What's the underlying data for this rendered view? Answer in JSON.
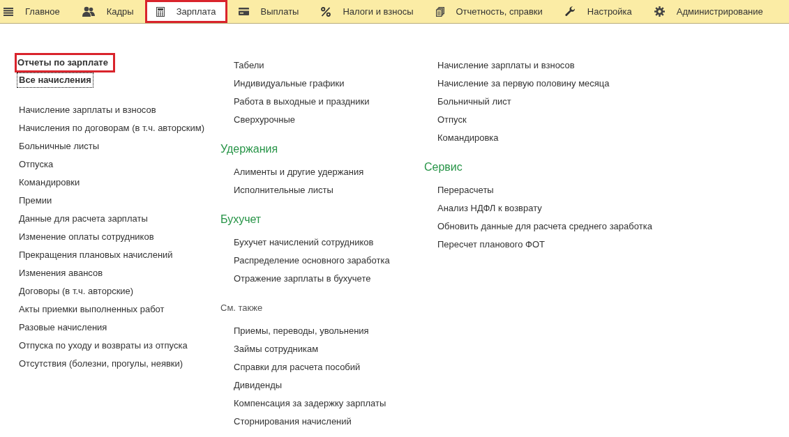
{
  "tabs": [
    {
      "label": "Главное",
      "selected": false,
      "highlighted": false
    },
    {
      "label": "Кадры",
      "selected": false,
      "highlighted": false
    },
    {
      "label": "Зарплата",
      "selected": true,
      "highlighted": true
    },
    {
      "label": "Выплаты",
      "selected": false,
      "highlighted": false
    },
    {
      "label": "Налоги и взносы",
      "selected": false,
      "highlighted": false
    },
    {
      "label": "Отчетность, справки",
      "selected": false,
      "highlighted": false
    },
    {
      "label": "Настройка",
      "selected": false,
      "highlighted": false
    },
    {
      "label": "Администрирование",
      "selected": false,
      "highlighted": false
    }
  ],
  "reports": [
    {
      "label": "Отчеты по зарплате",
      "highlighted": true,
      "focused": false
    },
    {
      "label": "Все начисления",
      "highlighted": false,
      "focused": true
    }
  ],
  "columns": [
    {
      "sections": [
        {
          "items": [
            "Начисление зарплаты и взносов",
            "Начисления по договорам (в т.ч. авторским)",
            "Больничные листы",
            "Отпуска",
            "Командировки",
            "Премии",
            "Данные для расчета зарплаты",
            "Изменение оплаты сотрудников",
            "Прекращения плановых начислений",
            "Изменения авансов",
            "Договоры (в т.ч. авторские)",
            "Акты приемки выполненных работ",
            "Разовые начисления",
            "Отпуска по уходу и возвраты из отпуска",
            "Отсутствия (болезни, прогулы, неявки)"
          ]
        }
      ]
    },
    {
      "sections": [
        {
          "items": [
            "Табели",
            "Индивидуальные графики",
            "Работа в выходные и праздники",
            "Сверхурочные"
          ]
        },
        {
          "title": "Удержания",
          "kind": "group",
          "items": [
            "Алименты и другие удержания",
            "Исполнительные листы"
          ]
        },
        {
          "title": "Бухучет",
          "kind": "group",
          "items": [
            "Бухучет начислений сотрудников",
            "Распределение основного заработка",
            "Отражение зарплаты в бухучете"
          ]
        },
        {
          "title": "См. также",
          "kind": "see_also",
          "items": [
            "Приемы, переводы, увольнения",
            "Займы сотрудникам",
            "Справки для расчета пособий",
            "Дивиденды",
            "Компенсация за задержку зарплаты",
            "Сторнирования начислений"
          ]
        }
      ]
    },
    {
      "sections": [
        {
          "items": [
            "Начисление зарплаты и взносов",
            "Начисление за первую половину месяца",
            "Больничный лист",
            "Отпуск",
            "Командировка"
          ]
        },
        {
          "title": "Сервис",
          "kind": "group",
          "items": [
            "Перерасчеты",
            "Анализ НДФЛ к возврату",
            "Обновить данные для расчета среднего заработка",
            "Пересчет планового ФОТ"
          ]
        }
      ]
    }
  ]
}
